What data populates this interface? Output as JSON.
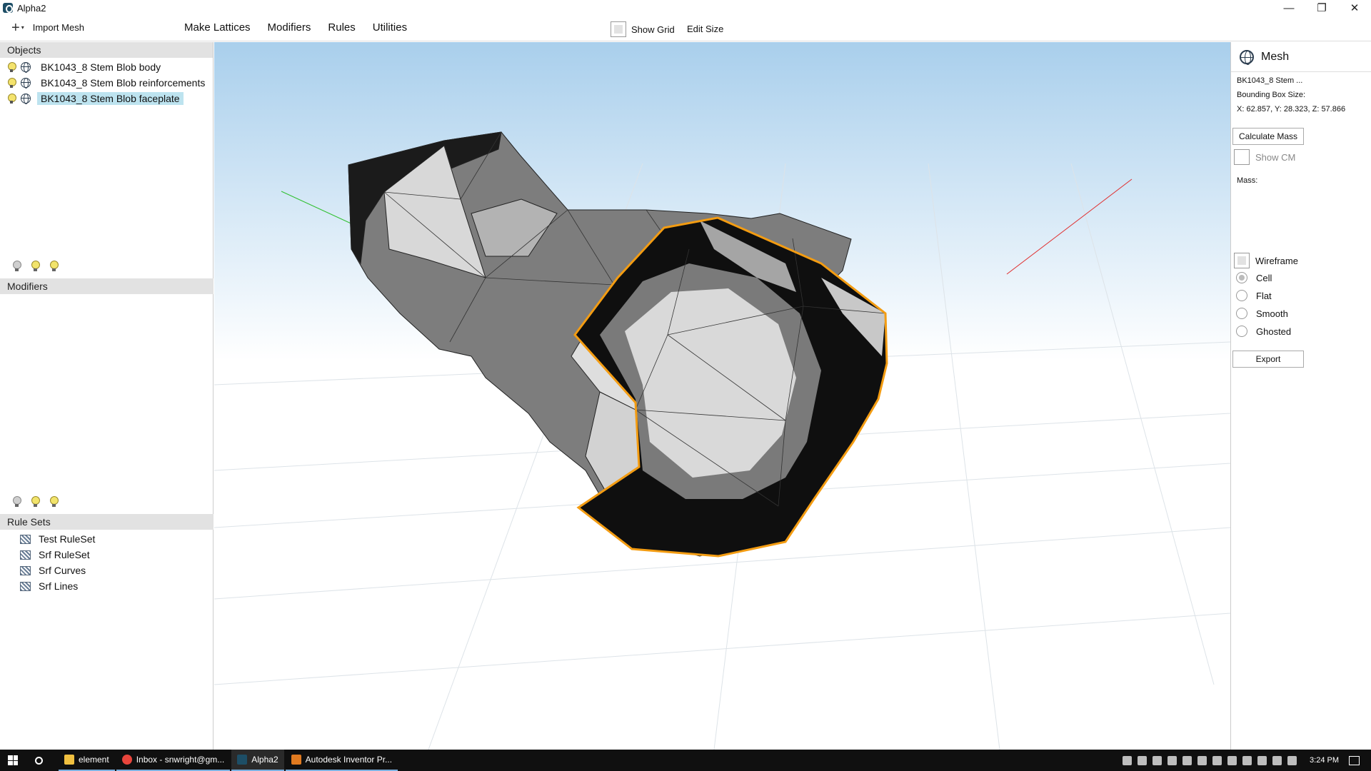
{
  "window": {
    "title": "Alpha2",
    "controls": [
      "—",
      "❐",
      "✕"
    ]
  },
  "menubar": {
    "import_label": "Import Mesh",
    "menus": [
      "Make Lattices",
      "Modifiers",
      "Rules",
      "Utilities"
    ],
    "show_grid_label": "Show Grid",
    "show_grid_checked": false,
    "edit_size_label": "Edit Size"
  },
  "objects": {
    "header": "Objects",
    "items": [
      {
        "label": "BK1043_8 Stem Blob body",
        "selected": false
      },
      {
        "label": "BK1043_8 Stem Blob reinforcements",
        "selected": false
      },
      {
        "label": "BK1043_8 Stem Blob faceplate",
        "selected": true
      }
    ]
  },
  "modifiers": {
    "header": "Modifiers"
  },
  "rulesets": {
    "header": "Rule Sets",
    "items": [
      "Test RuleSet",
      "Srf RuleSet",
      "Srf Curves",
      "Srf Lines"
    ]
  },
  "mesh_panel": {
    "title": "Mesh",
    "name": "BK1043_8 Stem ...",
    "bbox_label": "Bounding Box Size:",
    "bbox_value": "X: 62.857, Y: 28.323, Z: 57.866",
    "calculate_mass": "Calculate Mass",
    "show_cm": "Show CM",
    "mass_label": "Mass:",
    "wireframe": "Wireframe",
    "render_modes": [
      "Cell",
      "Flat",
      "Smooth",
      "Ghosted"
    ],
    "selected_mode": "Cell",
    "export": "Export"
  },
  "taskbar": {
    "items": [
      {
        "label": "element",
        "color": "#f0c040"
      },
      {
        "label": "Inbox - snwright@gm...",
        "color": "#e8453c"
      },
      {
        "label": "Alpha2",
        "color": "#1d4e66"
      },
      {
        "label": "Autodesk Inventor Pr...",
        "color": "#e07a20"
      }
    ],
    "active": "Alpha2",
    "time": "3:24 PM"
  },
  "colors": {
    "selection_outline": "#f39c12",
    "axis_x": "#e03030",
    "axis_y": "#30c030"
  }
}
